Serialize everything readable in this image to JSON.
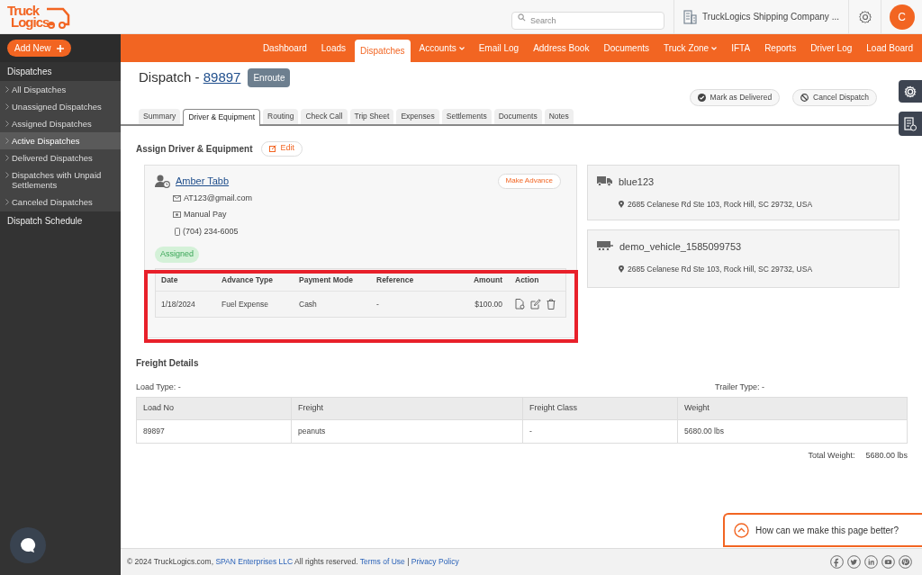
{
  "logo": {
    "line_1": "Truck",
    "line_2": "Logics"
  },
  "header": {
    "search": {
      "placeholder": "Search"
    },
    "company": "TruckLogics Shipping Company ...",
    "avatar": "C"
  },
  "sidebar": {
    "add_button": "Add New",
    "sections": [
      {
        "title": "Dispatches",
        "items": [
          {
            "label": "All Dispatches",
            "selected": false
          },
          {
            "label": "Unassigned Dispatches",
            "selected": false
          },
          {
            "label": "Assigned Dispatches",
            "selected": false
          },
          {
            "label": "Active Dispatches",
            "selected": true
          },
          {
            "label": "Delivered Dispatches",
            "selected": false
          },
          {
            "label": "Dispatches with Unpaid Settlements",
            "selected": false
          },
          {
            "label": "Canceled Dispatches",
            "selected": false
          }
        ]
      },
      {
        "title": "Dispatch Schedule"
      }
    ]
  },
  "nav": [
    {
      "label": "Dashboard",
      "selected": false,
      "dropdown": false
    },
    {
      "label": "Loads",
      "selected": false,
      "dropdown": false
    },
    {
      "label": "Dispatches",
      "selected": true,
      "dropdown": false
    },
    {
      "label": "Accounts",
      "selected": false,
      "dropdown": true
    },
    {
      "label": "Email Log",
      "selected": false,
      "dropdown": false
    },
    {
      "label": "Address Book",
      "selected": false,
      "dropdown": false
    },
    {
      "label": "Documents",
      "selected": false,
      "dropdown": false
    },
    {
      "label": "Truck Zone",
      "selected": false,
      "dropdown": true
    },
    {
      "label": "IFTA",
      "selected": false,
      "dropdown": false
    },
    {
      "label": "Reports",
      "selected": false,
      "dropdown": false
    },
    {
      "label": "Driver Log",
      "selected": false,
      "dropdown": false
    },
    {
      "label": "Load Board",
      "selected": false,
      "dropdown": false
    }
  ],
  "page": {
    "title": "Dispatch - ",
    "number": "89897",
    "status": "Enroute",
    "actions": [
      "Mark as Delivered",
      "Cancel Dispatch"
    ]
  },
  "tabs": [
    {
      "label": "Summary",
      "selected": false
    },
    {
      "label": "Driver & Equipment",
      "selected": true
    },
    {
      "label": "Routing",
      "selected": false
    },
    {
      "label": "Check Call",
      "selected": false
    },
    {
      "label": "Trip Sheet",
      "selected": false
    },
    {
      "label": "Expenses",
      "selected": false
    },
    {
      "label": "Settlements",
      "selected": false
    },
    {
      "label": "Documents",
      "selected": false
    },
    {
      "label": "Notes",
      "selected": false
    }
  ],
  "assign": {
    "title": "Assign Driver & Equipment",
    "edit_button": "Edit",
    "driver": {
      "name": "Amber Tabb",
      "advance_button": "Make Advance",
      "email": "AT123@gmail.com",
      "pay": "Manual Pay",
      "phone": "(704) 234-6005",
      "status": "Assigned",
      "advances": {
        "columns": [
          "Date",
          "Advance Type",
          "Payment Mode",
          "Reference",
          "Amount",
          "Action"
        ],
        "rows": [
          [
            "1/18/2024",
            "Fuel Expense",
            "Cash",
            "-",
            "$100.00"
          ]
        ]
      }
    },
    "vehicles": [
      {
        "kind": "truck",
        "name": "blue123",
        "address": "2685 Celanese Rd Ste 103, Rock Hill, SC 29732, USA"
      },
      {
        "kind": "trailer",
        "name": "demo_vehicle_1585099753",
        "address": "2685 Celanese Rd Ste 103, Rock Hill, SC 29732, USA"
      }
    ]
  },
  "freight": {
    "title": "Freight Details",
    "load_type": "Load Type: -",
    "trailer_type": "Trailer Type: -",
    "columns": [
      "Load No",
      "Freight",
      "Freight Class",
      "Weight"
    ],
    "rows": [
      [
        "89897",
        "peanuts",
        "-",
        "5680.00 lbs"
      ]
    ],
    "total_label": "Total Weight:",
    "total_value": "5680.00 lbs"
  },
  "feedback": "How can we make this page better?",
  "footer": [
    {
      "kind": "text",
      "text": "© 2024 TruckLogics.com, "
    },
    {
      "kind": "link",
      "text": "SPAN Enterprises LLC"
    },
    {
      "kind": "text",
      "text": " All rights reserved. "
    },
    {
      "kind": "link",
      "text": "Terms of Use"
    },
    {
      "kind": "text",
      "text": " | "
    },
    {
      "kind": "link",
      "text": "Privacy Policy"
    }
  ]
}
